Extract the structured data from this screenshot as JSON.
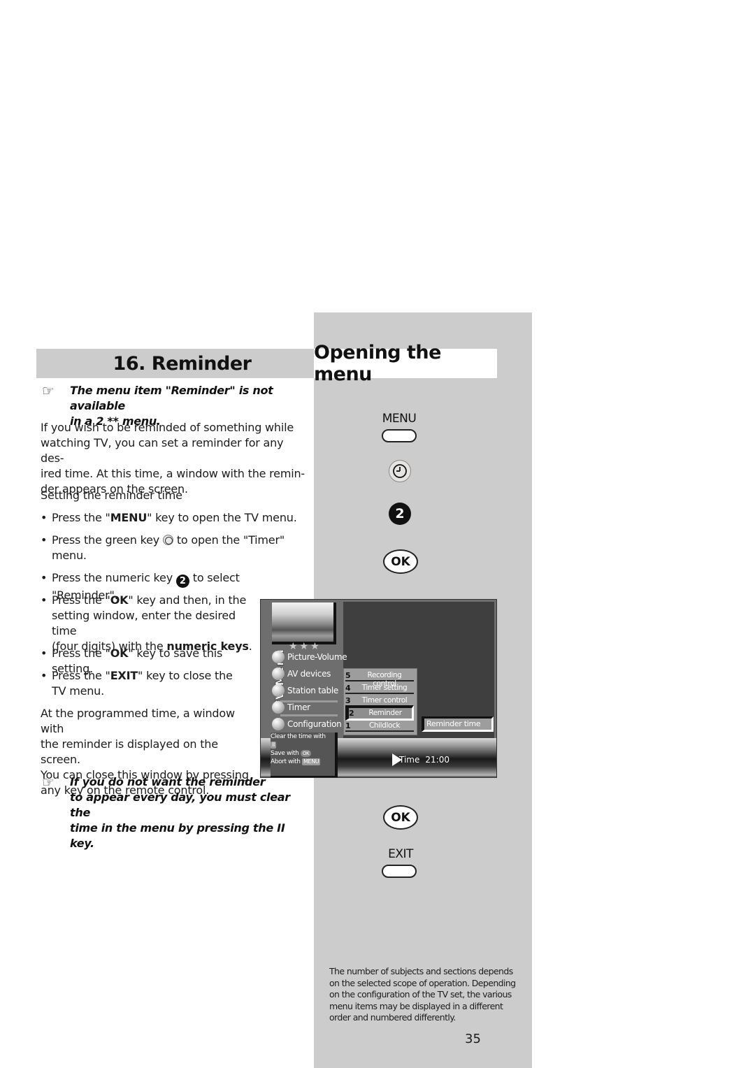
{
  "left_header": {
    "title": "16. Reminder"
  },
  "right_header": {
    "title": "Opening the menu"
  },
  "note_top": {
    "icon": "pointing-hand-icon",
    "line1": "The menu item \"Reminder\" is not available",
    "line2": "in a 2 ** menu."
  },
  "intro": {
    "lines": [
      "If you wish to be reminded of something while",
      "watching TV, you can set a reminder for any des-",
      "ired time. At this time, a window with the remin-",
      "der appears on the screen."
    ]
  },
  "section_title": "Setting the reminder time",
  "steps": [
    {
      "pre": "Press the \"",
      "bold": "MENU",
      "post": "\" key to open the TV menu."
    },
    {
      "pre": "Press the green key",
      "icon": "clock-icon",
      "post": "to open the \"Timer\"",
      "line2": "menu."
    },
    {
      "pre": "Press the numeric key",
      "num": "2",
      "post": "to select \"Reminder\"."
    },
    {
      "pre": "Press the \"",
      "bold": "OK",
      "post": "\" key and then, in the",
      "line2": "setting window, enter the desired time",
      "line3_pre": "(four digits) with the ",
      "line3_bold": "numeric keys",
      "line3_post": "."
    },
    {
      "pre": "Press the \"",
      "bold": "OK",
      "post": "\" key to save this setting."
    },
    {
      "pre": "Press the \"",
      "bold": "EXIT",
      "post": "\" key to close the",
      "line2": "TV menu."
    }
  ],
  "outro": {
    "lines": [
      "At the programmed time, a window with",
      "the reminder is displayed on the screen.",
      "You can close this window by pressing",
      "any key on the remote control."
    ]
  },
  "note_bottom": {
    "icon": "pointing-hand-icon",
    "line1": "If you do not want the reminder",
    "line2": "to appear every day, you must clear the",
    "line3": "time in the menu by pressing the II key."
  },
  "remote_keys": {
    "menu_label": "MENU",
    "clock_icon": "clock-icon",
    "number_key": "2",
    "ok_label_1": "OK",
    "ok_label_2": "OK",
    "exit_label": "EXIT"
  },
  "tv_screen": {
    "vertical_title": "TV-Menu",
    "stars": "★★★",
    "menu_items": [
      "Picture-Volume",
      "AV devices",
      "Station table",
      "Timer",
      "Configuration"
    ],
    "selected_menu_item": "Timer",
    "submenu": [
      {
        "num": "5",
        "label": "Recording control"
      },
      {
        "num": "4",
        "label": "Timer setting"
      },
      {
        "num": "3",
        "label": "Timer control"
      },
      {
        "num": "2",
        "label": "Reminder"
      },
      {
        "num": "1",
        "label": "Childlock"
      }
    ],
    "selected_submenu_item": "Reminder",
    "reminder_time_box": "Reminder time",
    "help": {
      "clear_label": "Clear the time with",
      "clear_key": "II",
      "save_label": "Save with",
      "save_key": "OK",
      "abort_label": "Abort with",
      "abort_key": "MENU"
    },
    "time_label": "Time",
    "time_value": "21:00"
  },
  "footnote": {
    "lines": [
      "The number of subjects and sections depends",
      "on the selected scope of operation. Depending",
      "on the configuration of the TV set, the various",
      "menu items may be displayed in a different",
      "order and numbered differently."
    ]
  },
  "page_number": "35"
}
